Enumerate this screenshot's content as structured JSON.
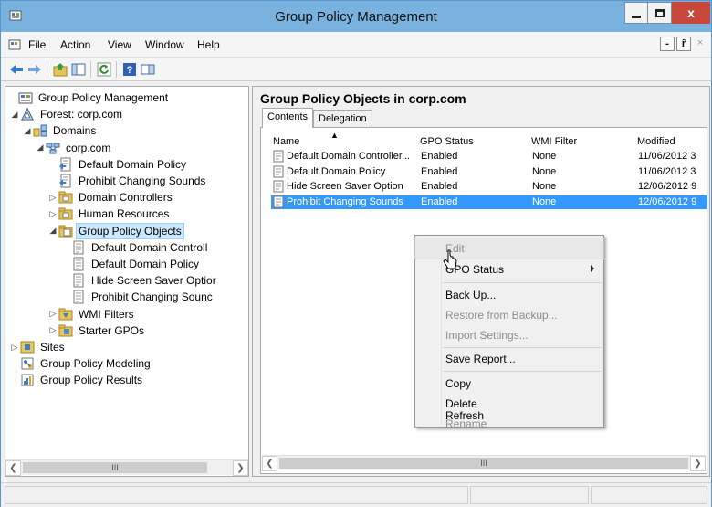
{
  "window": {
    "title": "Group Policy Management",
    "close_glyph": "x",
    "accent": "#7ab2df"
  },
  "menu": {
    "items": [
      "File",
      "Action",
      "View",
      "Window",
      "Help"
    ],
    "mdi_buttons": [
      "-",
      "ȓ",
      "×"
    ]
  },
  "toolbar": {
    "icons": [
      "back-arrow-icon",
      "forward-arrow-icon",
      "up-folder-icon",
      "show-hide-tree-icon",
      "refresh-icon",
      "help-icon",
      "show-console-icon"
    ]
  },
  "tree": {
    "nodes": [
      {
        "label": "Group Policy Management",
        "icon": "gpm-icon",
        "level": 0,
        "expander": ""
      },
      {
        "label": "Forest: corp.com",
        "icon": "forest-icon",
        "level": 1,
        "expander": "◢"
      },
      {
        "label": "Domains",
        "icon": "domains-icon",
        "level": 2,
        "expander": "◢"
      },
      {
        "label": "corp.com",
        "icon": "domain-icon",
        "level": 3,
        "expander": "◢"
      },
      {
        "label": "Default Domain Policy",
        "icon": "gpo-link-icon",
        "level": 4,
        "expander": ""
      },
      {
        "label": "Prohibit Changing Sounds",
        "icon": "gpo-link-icon",
        "level": 4,
        "expander": ""
      },
      {
        "label": "Domain Controllers",
        "icon": "ou-icon",
        "level": 4,
        "expander": "▷"
      },
      {
        "label": "Human Resources",
        "icon": "ou-icon",
        "level": 4,
        "expander": "▷"
      },
      {
        "label": "Group Policy Objects",
        "icon": "gpo-folder-icon",
        "level": 4,
        "expander": "◢",
        "selected": true
      },
      {
        "label": "Default Domain Controll",
        "icon": "gpo-icon",
        "level": 5,
        "expander": ""
      },
      {
        "label": "Default Domain Policy",
        "icon": "gpo-icon",
        "level": 5,
        "expander": ""
      },
      {
        "label": "Hide Screen Saver Optior",
        "icon": "gpo-icon",
        "level": 5,
        "expander": ""
      },
      {
        "label": "Prohibit Changing Sounc",
        "icon": "gpo-icon",
        "level": 5,
        "expander": ""
      },
      {
        "label": "WMI Filters",
        "icon": "wmi-folder-icon",
        "level": 4,
        "expander": "▷"
      },
      {
        "label": "Starter GPOs",
        "icon": "starter-folder-icon",
        "level": 4,
        "expander": "▷"
      },
      {
        "label": "Sites",
        "icon": "sites-icon",
        "level": 1,
        "expander": "▷"
      },
      {
        "label": "Group Policy Modeling",
        "icon": "modeling-icon",
        "level": 1,
        "expander": ""
      },
      {
        "label": "Group Policy Results",
        "icon": "results-icon",
        "level": 1,
        "expander": ""
      }
    ],
    "scroll_thumb": "III"
  },
  "details": {
    "title": "Group Policy Objects in corp.com",
    "tabs": [
      "Contents",
      "Delegation"
    ],
    "columns": [
      "Name",
      "GPO Status",
      "WMI Filter",
      "Modified"
    ],
    "sort_glyph": "▲",
    "rows": [
      {
        "name": "Default Domain Controller...",
        "status": "Enabled",
        "wmi": "None",
        "modified": "11/06/2012 3"
      },
      {
        "name": "Default Domain Policy",
        "status": "Enabled",
        "wmi": "None",
        "modified": "11/06/2012 3"
      },
      {
        "name": "Hide Screen Saver Option",
        "status": "Enabled",
        "wmi": "None",
        "modified": "12/06/2012 9"
      },
      {
        "name": "Prohibit Changing Sounds",
        "status": "Enabled",
        "wmi": "None",
        "modified": "12/06/2012 9",
        "selected": true
      }
    ],
    "scroll_thumb": "III"
  },
  "context_menu": {
    "edit": "Edit",
    "gpo_status": "GPO Status",
    "back_up": "Back Up...",
    "restore": "Restore from Backup...",
    "import": "Import Settings...",
    "save_report": "Save Report...",
    "copy": "Copy",
    "delete": "Delete",
    "rename": "Rename",
    "refresh": "Refresh"
  }
}
